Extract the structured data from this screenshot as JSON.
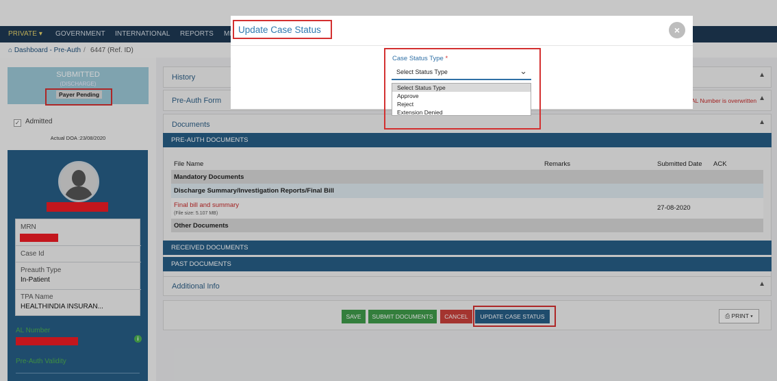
{
  "nav": {
    "items": [
      "PRIVATE ▾",
      "GOVERNMENT",
      "INTERNATIONAL",
      "REPORTS",
      "MI"
    ]
  },
  "breadcrumb": {
    "home": "Dashboard - Pre-Auth",
    "separator": "/",
    "ref": "6447  (Ref. ID)"
  },
  "status_card": {
    "status": "SUBMITTED",
    "substatus": "(DISCHARGE)",
    "badge": "Payer Pending"
  },
  "admitted": {
    "label": "Admitted",
    "checked": true,
    "doa": "Actual DOA :23/08/2020"
  },
  "profile": {
    "fields": [
      {
        "label": "MRN",
        "value": ""
      },
      {
        "label": "Case Id",
        "value": ""
      },
      {
        "label": "Preauth Type",
        "value": "In-Patient"
      },
      {
        "label": "TPA Name",
        "value": "HEALTHINDIA INSURAN..."
      }
    ],
    "al_number_label": "AL Number",
    "validity_label": "Pre-Auth Validity"
  },
  "panels": {
    "history": "History",
    "preauth_form": "Pre-Auth Form",
    "documents": "Documents",
    "additional_info": "Additional Info",
    "warning": "AL Number is overwritten"
  },
  "sections": {
    "preauth_docs": "PRE-AUTH DOCUMENTS",
    "received_docs": "RECEIVED DOCUMENTS",
    "past_docs": "PAST DOCUMENTS"
  },
  "doc_table": {
    "headers": [
      "File Name",
      "Remarks",
      "Submitted Date",
      "ACK"
    ],
    "group_mandatory": "Mandatory Documents",
    "subgroup": "Discharge Summary/Investigation Reports/Final Bill",
    "file_name": "Final bill and summary",
    "file_size": "(File size: 5.107 MB)",
    "file_date": "27-08-2020",
    "group_other": "Other Documents"
  },
  "actions": {
    "save": "SAVE",
    "submit_documents": "SUBMIT DOCUMENTS",
    "cancel": "CANCEL",
    "update_case_status": "UPDATE CASE STATUS",
    "print": "PRINT ▾"
  },
  "colors": {
    "save": "#3f9a4a",
    "submit": "#3f9a4a",
    "cancel": "#c9403a",
    "update": "#275d85"
  },
  "modal": {
    "title": "Update Case Status",
    "close_icon": "close-icon",
    "field_label": "Case Status Type",
    "required_mark": "*",
    "selected": "Select Status Type",
    "options": [
      "Select Status Type",
      "Approve",
      "Reject",
      "Extension Denied"
    ]
  }
}
